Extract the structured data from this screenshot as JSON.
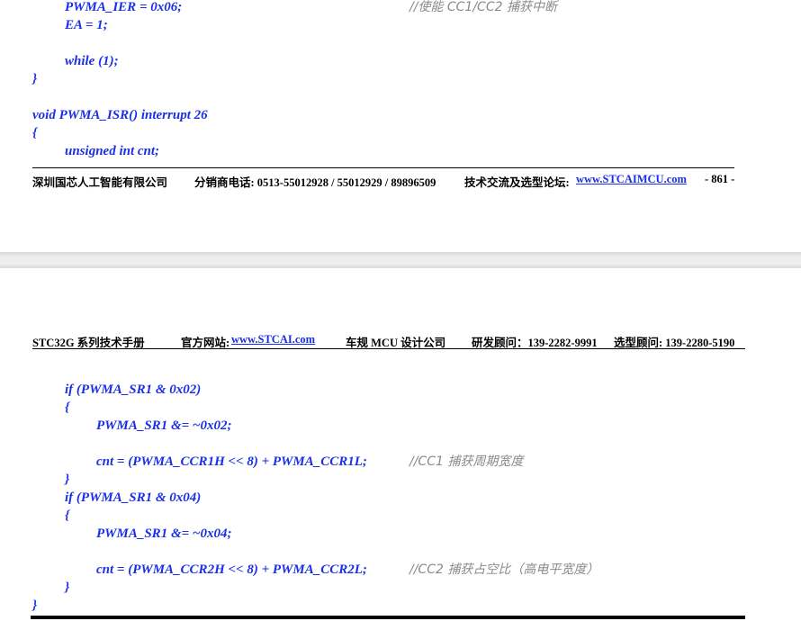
{
  "top_page": {
    "code_lines": [
      "PWMA_IER = 0x06;",
      "EA = 1;",
      "while (1);",
      "}",
      "void PWMA_ISR() interrupt 26",
      "{",
      "unsigned int cnt;"
    ],
    "comment_ier": "//使能 CC1/CC2 捕获中断",
    "footer": {
      "company": "深圳国芯人工智能有限公司",
      "phone": "分销商电话: 0513-55012928 / 55012929 / 89896509",
      "forum_label": "技术交流及选型论坛:",
      "forum_link": "www.STCAIMCU.com",
      "page_number": "- 861 -"
    }
  },
  "bottom_page": {
    "header": {
      "manual": "STC32G 系列技术手册",
      "site_label": "官方网站: ",
      "site_link": "www.STCAI.com",
      "design": "车规 MCU 设计公司",
      "rd": "研发顾问：139-2282-9991",
      "sales": "选型顾问: 139-2280-5190"
    },
    "code_lines": [
      "if (PWMA_SR1 & 0x02)",
      "{",
      "PWMA_SR1 &= ~0x02;",
      "cnt = (PWMA_CCR1H << 8) + PWMA_CCR1L;",
      "}",
      "if (PWMA_SR1 & 0x04)",
      "{",
      "PWMA_SR1 &= ~0x04;",
      "cnt = (PWMA_CCR2H << 8) + PWMA_CCR2L;",
      "}",
      "}"
    ],
    "comment_cc1": "//CC1 捕获周期宽度",
    "comment_cc2": "//CC2 捕获占空比（高电平宽度）"
  }
}
